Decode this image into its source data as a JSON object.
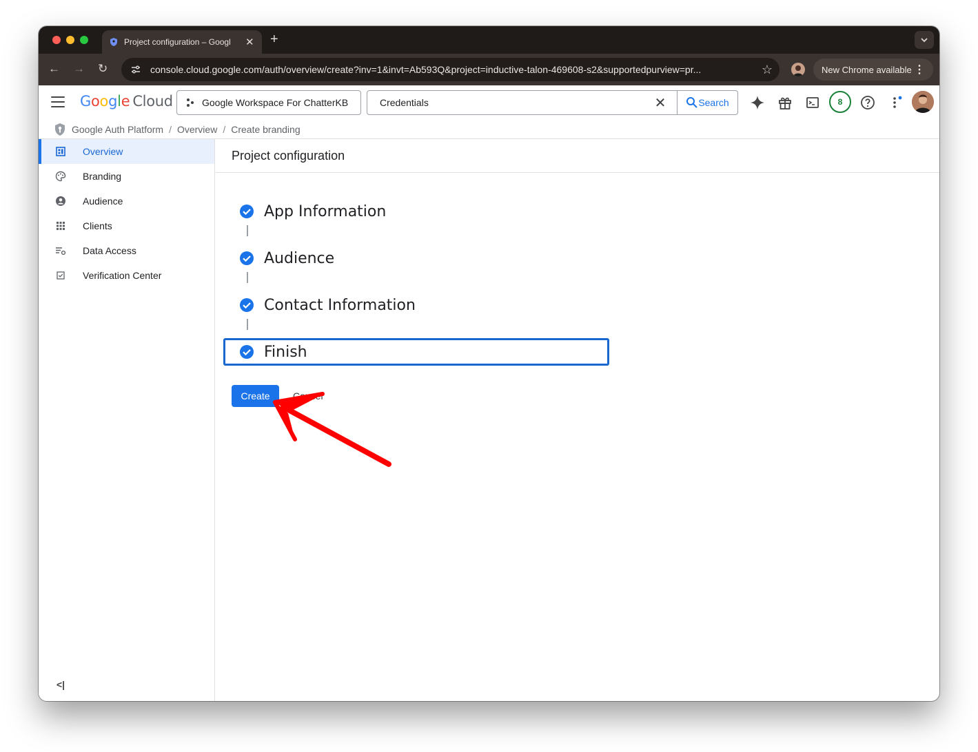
{
  "browser": {
    "tab_title": "Project configuration – Googl",
    "url": "console.cloud.google.com/auth/overview/create?inv=1&invt=Ab593Q&project=inductive-talon-469608-s2&supportedpurview=pr...",
    "update_label": "New Chrome available"
  },
  "header": {
    "logo_google": "Google",
    "logo_cloud": "Cloud",
    "project_name": "Google Workspace For ChatterKB",
    "search_value": "Credentials",
    "search_button": "Search",
    "notification_count": "8"
  },
  "breadcrumb": {
    "items": [
      "Google Auth Platform",
      "Overview",
      "Create branding"
    ],
    "separator": "/"
  },
  "sidebar": {
    "items": [
      {
        "label": "Overview",
        "icon": "dashboard-icon",
        "active": true
      },
      {
        "label": "Branding",
        "icon": "palette-icon"
      },
      {
        "label": "Audience",
        "icon": "account-icon"
      },
      {
        "label": "Clients",
        "icon": "grid-icon"
      },
      {
        "label": "Data Access",
        "icon": "list-settings-icon"
      },
      {
        "label": "Verification Center",
        "icon": "checkbox-icon"
      }
    ],
    "collapse_label": "<|"
  },
  "main": {
    "title": "Project configuration",
    "steps": [
      {
        "label": "App Information",
        "status": "done"
      },
      {
        "label": "Audience",
        "status": "done"
      },
      {
        "label": "Contact Information",
        "status": "done"
      },
      {
        "label": "Finish",
        "status": "done"
      }
    ],
    "create_label": "Create",
    "cancel_label": "Cancel"
  },
  "colors": {
    "accent": "#1a73e8",
    "annotation_arrow": "#ff0000"
  }
}
